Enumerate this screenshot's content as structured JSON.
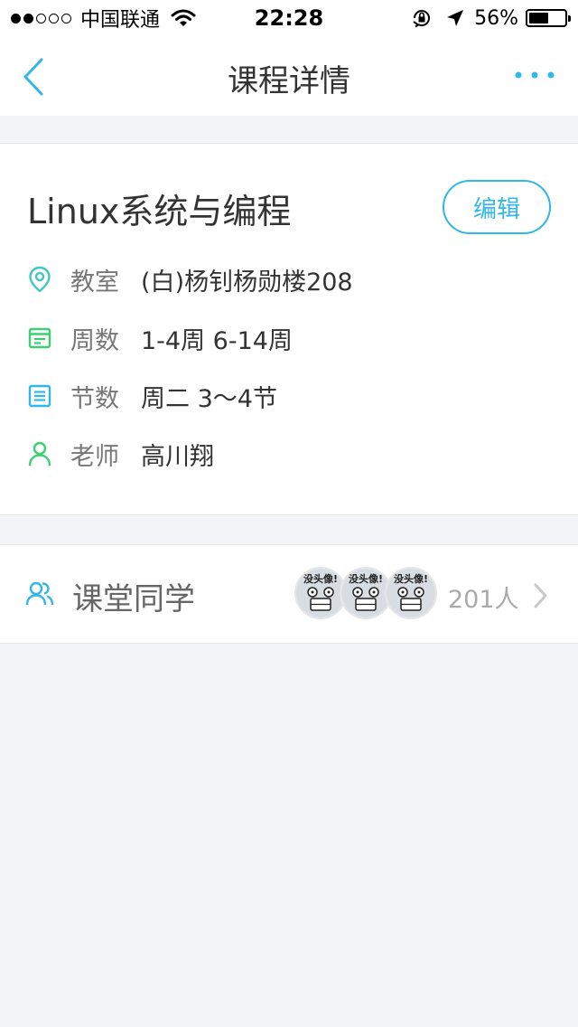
{
  "status_bar": {
    "carrier": "中国联通",
    "time": "22:28",
    "battery_percent": "56%",
    "battery_level": 0.56,
    "signal_bars_filled": 2,
    "signal_bars_total": 5
  },
  "nav": {
    "title": "课程详情",
    "back_icon": "chevron-left-icon",
    "more_icon": "more-dots-icon"
  },
  "course": {
    "name": "Linux系统与编程",
    "edit_label": "编辑",
    "rows": {
      "classroom": {
        "label": "教室",
        "value": "(白)杨钊杨勋楼208",
        "icon": "location-pin-icon"
      },
      "weeks": {
        "label": "周数",
        "value": "1-4周 6-14周",
        "icon": "calendar-icon"
      },
      "periods": {
        "label": "节数",
        "value": "周二 3～4节",
        "icon": "list-icon"
      },
      "teacher": {
        "label": "老师",
        "value": "高川翔",
        "icon": "person-icon"
      }
    }
  },
  "classmates": {
    "label": "课堂同学",
    "count": "201人",
    "avatar_caption": "没头像!"
  },
  "colors": {
    "accent": "#31b7e8",
    "teal": "#3cc8c0",
    "green": "#3ccf72",
    "background": "#f2f4f7"
  }
}
